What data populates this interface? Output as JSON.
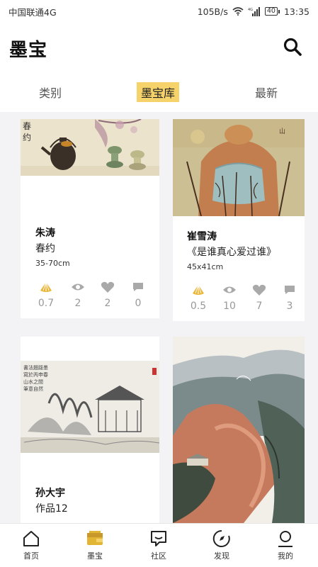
{
  "status_bar": {
    "carrier": "中国联通4G",
    "speed": "105B/s",
    "network": "4G",
    "battery": "40",
    "time": "13:35"
  },
  "header": {
    "title": "墨宝",
    "search_icon": "search-icon"
  },
  "tabs": [
    {
      "label": "类别",
      "active": false
    },
    {
      "label": "墨宝库",
      "active": true
    },
    {
      "label": "最新",
      "active": false
    }
  ],
  "cards": [
    {
      "artist": "朱涛",
      "title": "春约",
      "size": "35-70cm",
      "stats": {
        "shells": "0.7",
        "views": "2",
        "likes": "2",
        "comments": "0"
      }
    },
    {
      "artist": "崔雪涛",
      "title": "《是谁真心爱过谁》",
      "size": "45x41cm",
      "stats": {
        "shells": "0.5",
        "views": "10",
        "likes": "7",
        "comments": "3"
      }
    },
    {
      "artist": "孙大宇",
      "title": "作品12",
      "size": "",
      "stats": {}
    },
    {
      "artist": "",
      "title": "",
      "size": "",
      "stats": {}
    }
  ],
  "bottom_nav": [
    {
      "label": "首页",
      "icon": "home-icon",
      "active": false
    },
    {
      "label": "墨宝",
      "icon": "wallet-icon",
      "active": true
    },
    {
      "label": "社区",
      "icon": "chat-icon",
      "active": false
    },
    {
      "label": "发现",
      "icon": "compass-icon",
      "active": false
    },
    {
      "label": "我的",
      "icon": "person-icon",
      "active": false
    }
  ],
  "colors": {
    "accent": "#f6d26a",
    "accent_dark": "#e2b534",
    "stat_icon": "#a9a9a9",
    "background": "#f3f3f5"
  }
}
